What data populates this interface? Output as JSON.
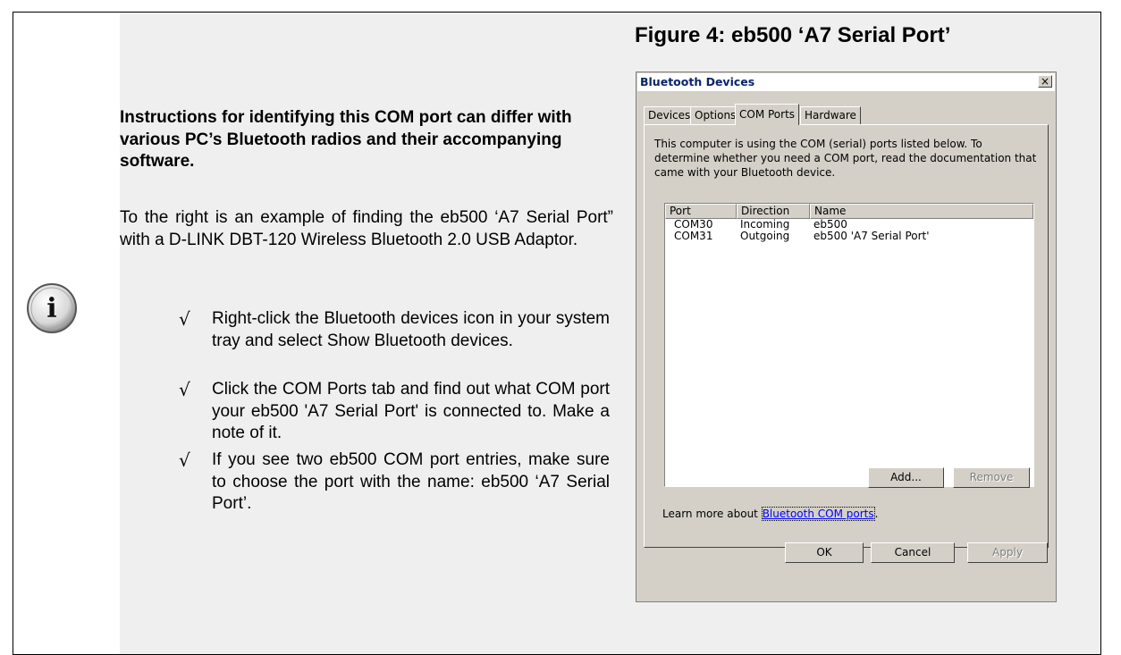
{
  "figure_title": "Figure 4: eb500 ‘A7 Serial Port’",
  "bold_paragraph": "Instructions for identifying this COM port can differ with various PC’s Bluetooth radios and their accompanying software.",
  "paragraph": "To the right is an example of finding the eb500 ‘A7 Serial Port” with a D-LINK DBT-120 Wireless Bluetooth 2.0 USB Adaptor.",
  "check_symbol": "√",
  "steps": [
    "Right-click the Bluetooth devices icon in your system tray and select Show Bluetooth devices.",
    "Click the COM Ports tab and find out what COM port your eb500 'A7 Serial Port' is connected to. Make a note of it.",
    "If you see two eb500 COM port entries, make sure to choose the port with the name: eb500 ‘A7 Serial Port’."
  ],
  "info_icon_glyph": "i",
  "dialog": {
    "title": "Bluetooth Devices",
    "close_glyph": "×",
    "tabs": [
      "Devices",
      "Options",
      "COM Ports",
      "Hardware"
    ],
    "active_tab": "COM Ports",
    "description": "This computer is using the COM (serial) ports listed below. To determine whether you need a COM port, read the documentation that came with your Bluetooth device.",
    "columns": [
      "Port",
      "Direction",
      "Name"
    ],
    "rows": [
      {
        "port": "COM30",
        "direction": "Incoming",
        "name": "eb500"
      },
      {
        "port": "COM31",
        "direction": "Outgoing",
        "name": "eb500 'A7 Serial Port'"
      }
    ],
    "add_button": "Add...",
    "remove_button": "Remove",
    "learn_prefix": "Learn more about ",
    "learn_link": "Bluetooth COM ports",
    "learn_suffix": ".",
    "ok_button": "OK",
    "cancel_button": "Cancel",
    "apply_button": "Apply"
  }
}
